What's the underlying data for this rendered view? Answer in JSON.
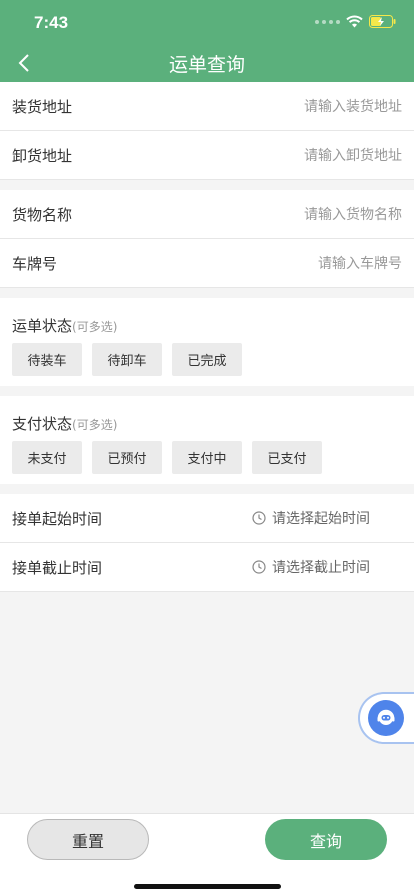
{
  "status_bar": {
    "time": "7:43"
  },
  "header": {
    "title": "运单查询"
  },
  "fields": [
    {
      "label": "装货地址",
      "placeholder": "请输入装货地址"
    },
    {
      "label": "卸货地址",
      "placeholder": "请输入卸货地址"
    },
    {
      "label": "货物名称",
      "placeholder": "请输入货物名称"
    },
    {
      "label": "车牌号",
      "placeholder": "请输入车牌号"
    }
  ],
  "waybill_status": {
    "title": "运单状态",
    "hint": "(可多选)",
    "options": [
      "待装车",
      "待卸车",
      "已完成"
    ]
  },
  "pay_status": {
    "title": "支付状态",
    "hint": "(可多选)",
    "options": [
      "未支付",
      "已预付",
      "支付中",
      "已支付"
    ]
  },
  "time_fields": [
    {
      "label": "接单起始时间",
      "placeholder": "请选择起始时间"
    },
    {
      "label": "接单截止时间",
      "placeholder": "请选择截止时间"
    }
  ],
  "footer": {
    "reset_label": "重置",
    "query_label": "查询"
  },
  "colors": {
    "primary": "#5bb07c",
    "float_button": "#4f84ea",
    "background": "#f4f4f4"
  },
  "icons": [
    "back-arrow-icon",
    "wifi-icon",
    "battery-charging-icon",
    "clock-icon",
    "customer-service-icon"
  ]
}
